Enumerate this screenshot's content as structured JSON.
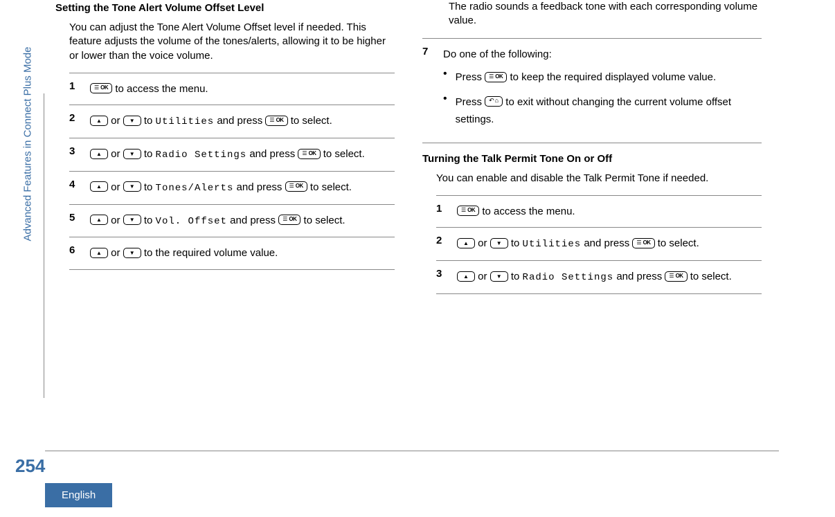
{
  "sidebar_label": "Advanced Features in Connect Plus Mode",
  "page_number": "254",
  "language": "English",
  "left": {
    "section_title": "Setting the Tone Alert Volume Offset Level",
    "intro": "You can adjust the Tone Alert Volume Offset level if needed. This feature adjusts the volume of the tones/alerts, allowing it to be higher or lower than the voice volume.",
    "steps": {
      "1": {
        "num": "1",
        "after_icon": " to access the menu."
      },
      "2": {
        "num": "2",
        "or": " or ",
        "to": " to ",
        "menu": "Utilities",
        "and_press": " and press ",
        "to_select": " to select."
      },
      "3": {
        "num": "3",
        "or": " or ",
        "to": " to ",
        "menu": "Radio Settings",
        "and_press": " and press ",
        "to_select": " to select."
      },
      "4": {
        "num": "4",
        "or": " or ",
        "to": " to ",
        "menu": "Tones/Alerts",
        "and_press": " and press ",
        "to_select": " to select."
      },
      "5": {
        "num": "5",
        "or": " or ",
        "to": " to ",
        "menu": "Vol. Offset",
        "and_press": " and press ",
        "to_select": " to select."
      },
      "6": {
        "num": "6",
        "or": " or ",
        "tail": " to the required volume value."
      }
    }
  },
  "right": {
    "feedback": "The radio sounds a feedback tone with each corresponding volume value.",
    "step7": {
      "num": "7",
      "intro": "Do one of the following:",
      "bullets": {
        "a": {
          "press": "Press ",
          "tail": " to keep the required displayed volume value."
        },
        "b": {
          "press": "Press ",
          "tail": " to exit without changing the current volume offset settings."
        }
      }
    },
    "section_title": "Turning the Talk Permit Tone On or Off",
    "intro": "You can enable and disable the Talk Permit Tone if needed.",
    "steps": {
      "1": {
        "num": "1",
        "after_icon": " to access the menu."
      },
      "2": {
        "num": "2",
        "or": " or ",
        "to": " to ",
        "menu": "Utilities",
        "and_press": " and press ",
        "to_select": " to select."
      },
      "3": {
        "num": "3",
        "or": " or ",
        "to": " to ",
        "menu": "Radio Settings",
        "and_press": " and press ",
        "to_select": " to select."
      }
    }
  }
}
